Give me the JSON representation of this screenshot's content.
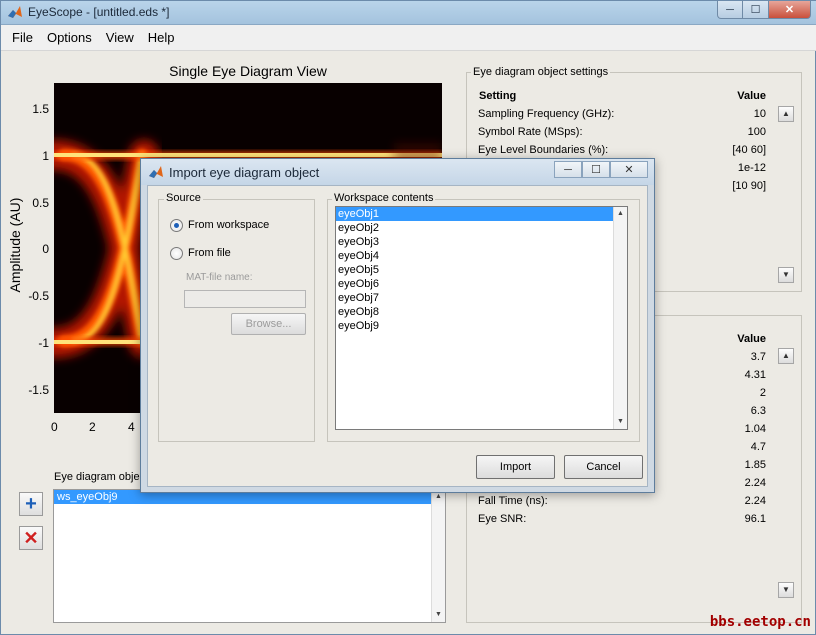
{
  "window": {
    "title": "EyeScope - [untitled.eds *]",
    "controls": {
      "minimize": "─",
      "maximize": "☐",
      "close": "✕"
    }
  },
  "menu": [
    "File",
    "Options",
    "View",
    "Help"
  ],
  "plot": {
    "title": "Single Eye Diagram View",
    "ylabel": "Amplitude (AU)",
    "yticks": [
      "1.5",
      "1",
      "0.5",
      "0",
      "-0.5",
      "-1",
      "-1.5"
    ],
    "xticks": [
      "0",
      "2",
      "4"
    ],
    "colors": {
      "background": "#080000",
      "trace": "#ffcc33",
      "hot": "#ff2a00"
    }
  },
  "eye_list": {
    "label": "Eye diagram objec",
    "items": [
      "ws_eyeObj9"
    ]
  },
  "side_buttons": {
    "add": "+",
    "delete": "✕"
  },
  "settings_panel": {
    "title": "Eye diagram object settings",
    "header_setting": "Setting",
    "header_value": "Value",
    "rows": [
      {
        "label": "Sampling Frequency (GHz):",
        "value": "10"
      },
      {
        "label": "Symbol Rate (MSps):",
        "value": "100"
      },
      {
        "label": "Eye Level Boundaries (%):",
        "value": "[40 60]"
      },
      {
        "label": "",
        "value": "1e-12"
      },
      {
        "label": "",
        "value": "[10 90]"
      }
    ]
  },
  "measurements_panel": {
    "header_value": "Value",
    "values": [
      "3.7",
      "4.31",
      "2",
      "6.3",
      "1.04",
      "4.7",
      "1.85",
      "2.24"
    ],
    "rows": [
      {
        "label": "Fall Time (ns):",
        "value": "2.24"
      },
      {
        "label": "Eye SNR:",
        "value": "96.1"
      }
    ]
  },
  "watermark": "bbs.eetop.cn",
  "dialog": {
    "title": "Import eye diagram object",
    "controls": {
      "minimize": "─",
      "maximize": "☐",
      "close": "✕"
    },
    "source": {
      "title": "Source",
      "from_workspace": "From workspace",
      "from_file": "From file",
      "selected": "From workspace",
      "matfile_label": "MAT-file name:",
      "matfile_value": "",
      "browse_label": "Browse..."
    },
    "workspace": {
      "title": "Workspace contents",
      "items": [
        "eyeObj1",
        "eyeObj2",
        "eyeObj3",
        "eyeObj4",
        "eyeObj5",
        "eyeObj6",
        "eyeObj7",
        "eyeObj8",
        "eyeObj9"
      ],
      "selected": "eyeObj1"
    },
    "import_label": "Import",
    "cancel_label": "Cancel"
  }
}
